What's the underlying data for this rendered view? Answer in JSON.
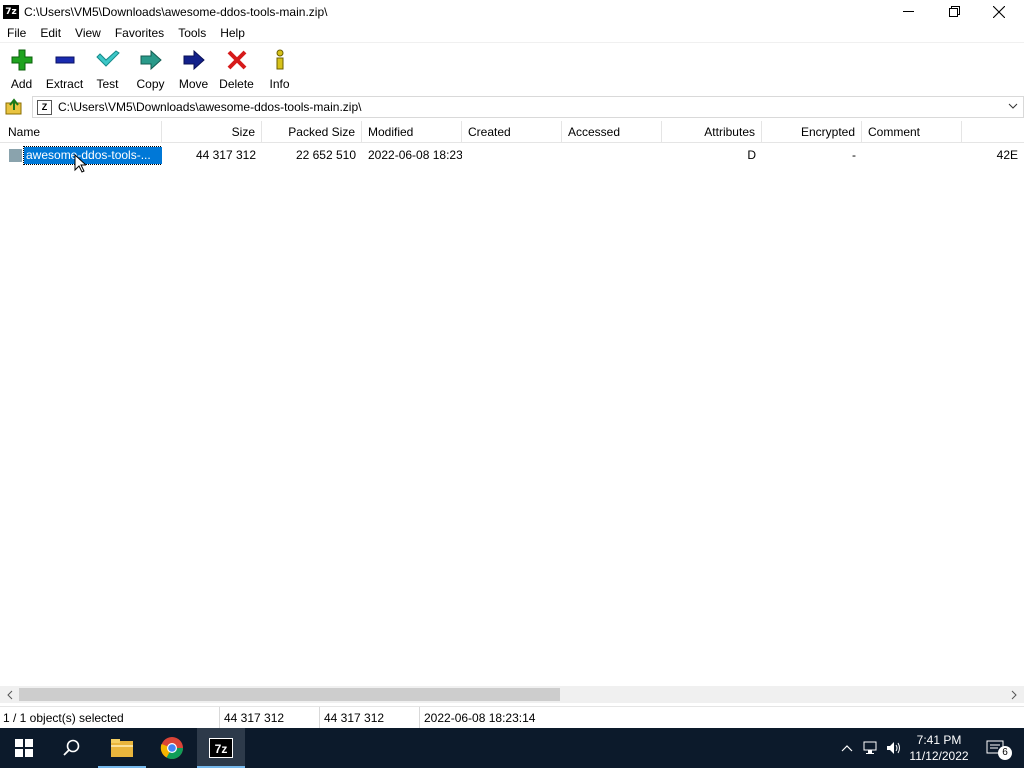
{
  "window": {
    "app_icon_text": "7z",
    "title": "C:\\Users\\VM5\\Downloads\\awesome-ddos-tools-main.zip\\"
  },
  "menu": [
    "File",
    "Edit",
    "View",
    "Favorites",
    "Tools",
    "Help"
  ],
  "toolbar": [
    {
      "label": "Add",
      "icon": "plus-icon"
    },
    {
      "label": "Extract",
      "icon": "minus-icon"
    },
    {
      "label": "Test",
      "icon": "check-icon"
    },
    {
      "label": "Copy",
      "icon": "copy-arrow-icon"
    },
    {
      "label": "Move",
      "icon": "move-arrow-icon"
    },
    {
      "label": "Delete",
      "icon": "delete-x-icon"
    },
    {
      "label": "Info",
      "icon": "info-icon"
    }
  ],
  "address": {
    "path": "C:\\Users\\VM5\\Downloads\\awesome-ddos-tools-main.zip\\"
  },
  "columns": [
    "Name",
    "Size",
    "Packed Size",
    "Modified",
    "Created",
    "Accessed",
    "Attributes",
    "Encrypted",
    "Comment",
    ""
  ],
  "rows": [
    {
      "name": "awesome-ddos-tools-...",
      "size": "44 317 312",
      "packed_size": "22 652 510",
      "modified": "2022-06-08 18:23",
      "created": "",
      "accessed": "",
      "attributes": "D",
      "encrypted": "-",
      "comment": "",
      "extra": "42E",
      "selected": true
    }
  ],
  "status": {
    "selection": "1 / 1 object(s) selected",
    "size": "44 317 312",
    "packed": "44 317 312",
    "modified": "2022-06-08 18:23:14"
  },
  "taskbar": {
    "apps": [
      "start-icon",
      "search-icon",
      "file-explorer-icon",
      "chrome-icon",
      "7zip-icon"
    ],
    "seven_zip_label": "7z",
    "time": "7:41 PM",
    "date": "11/12/2022",
    "notification_count": "6"
  },
  "colors": {
    "selection": "#0078d7",
    "taskbar": "#0c1a2b"
  }
}
